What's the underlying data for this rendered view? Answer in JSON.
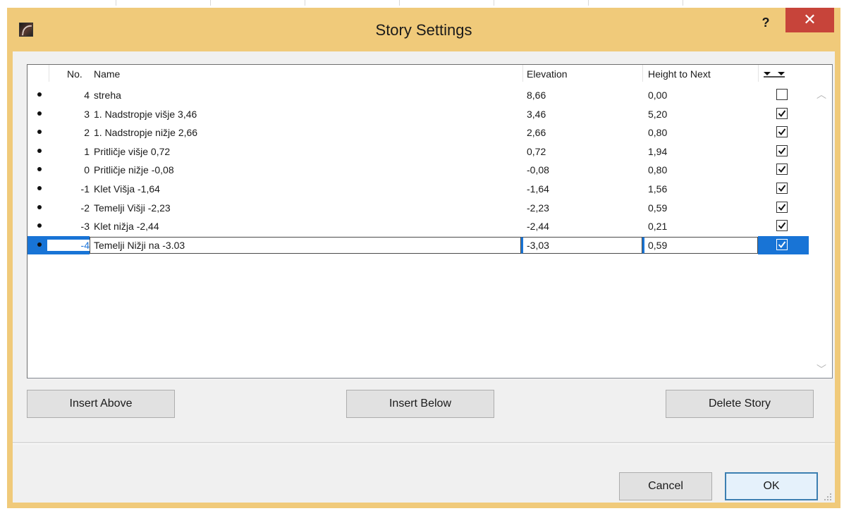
{
  "window": {
    "title": "Story Settings",
    "help_label": "?",
    "close_label": "✕"
  },
  "table": {
    "headers": {
      "no": "No.",
      "name": "Name",
      "elevation": "Elevation",
      "height_to_next": "Height to Next"
    },
    "rows": [
      {
        "no": "4",
        "name": "streha",
        "elevation": "8,66",
        "height_to_next": "0,00",
        "checked": false
      },
      {
        "no": "3",
        "name": "1. Nadstropje višje 3,46",
        "elevation": "3,46",
        "height_to_next": "5,20",
        "checked": true
      },
      {
        "no": "2",
        "name": "1. Nadstropje nižje 2,66",
        "elevation": "2,66",
        "height_to_next": "0,80",
        "checked": true
      },
      {
        "no": "1",
        "name": "Pritličje višje 0,72",
        "elevation": "0,72",
        "height_to_next": "1,94",
        "checked": true
      },
      {
        "no": "0",
        "name": "Pritličje nižje -0,08",
        "elevation": "-0,08",
        "height_to_next": "0,80",
        "checked": true
      },
      {
        "no": "-1",
        "name": "Klet Višja -1,64",
        "elevation": "-1,64",
        "height_to_next": "1,56",
        "checked": true
      },
      {
        "no": "-2",
        "name": "Temelji Višji -2,23",
        "elevation": "-2,23",
        "height_to_next": "0,59",
        "checked": true
      },
      {
        "no": "-3",
        "name": "Klet nižja -2,44",
        "elevation": "-2,44",
        "height_to_next": "0,21",
        "checked": true
      },
      {
        "no": "-4",
        "name": "Temelji Nižji na -3.03",
        "elevation": "-3,03",
        "height_to_next": "0,59",
        "checked": true
      }
    ],
    "selected_index": 8
  },
  "buttons": {
    "insert_above": "Insert Above",
    "insert_below": "Insert Below",
    "delete_story": "Delete Story",
    "cancel": "Cancel",
    "ok": "OK"
  },
  "colors": {
    "title_bar": "#f0ca7a",
    "close_button": "#c7443a",
    "selection": "#1874d6",
    "dialog_bg": "#f0f0f0"
  }
}
